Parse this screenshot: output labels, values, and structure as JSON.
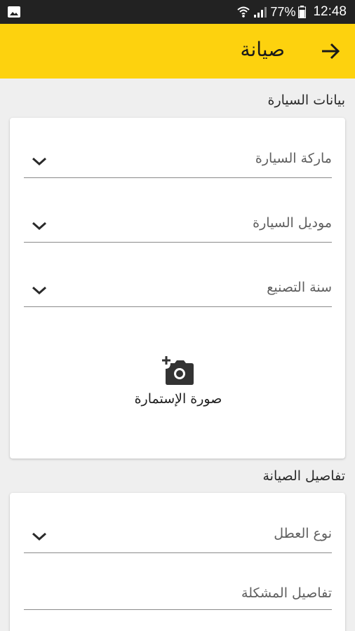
{
  "status_bar": {
    "battery": "77%",
    "time": "12:48"
  },
  "app_bar": {
    "title": "صيانة"
  },
  "car_section": {
    "title": "بيانات السيارة",
    "brand_label": "ماركة السيارة",
    "model_label": "موديل السيارة",
    "year_label": "سنة التصنيع",
    "photo_label": "صورة الإستمارة"
  },
  "maintenance_section": {
    "title": "تفاصيل الصيانة",
    "fault_type_label": "نوع العطل",
    "details_placeholder": "تفاصيل المشكلة"
  },
  "colors": {
    "accent": "#fdd20e",
    "status_bar": "#222222",
    "background": "#efefef"
  },
  "icons": [
    "gallery-icon",
    "wifi-icon",
    "signal-icon",
    "battery-icon",
    "arrow-right-icon",
    "chevron-down-icon",
    "add-photo-camera-icon"
  ]
}
